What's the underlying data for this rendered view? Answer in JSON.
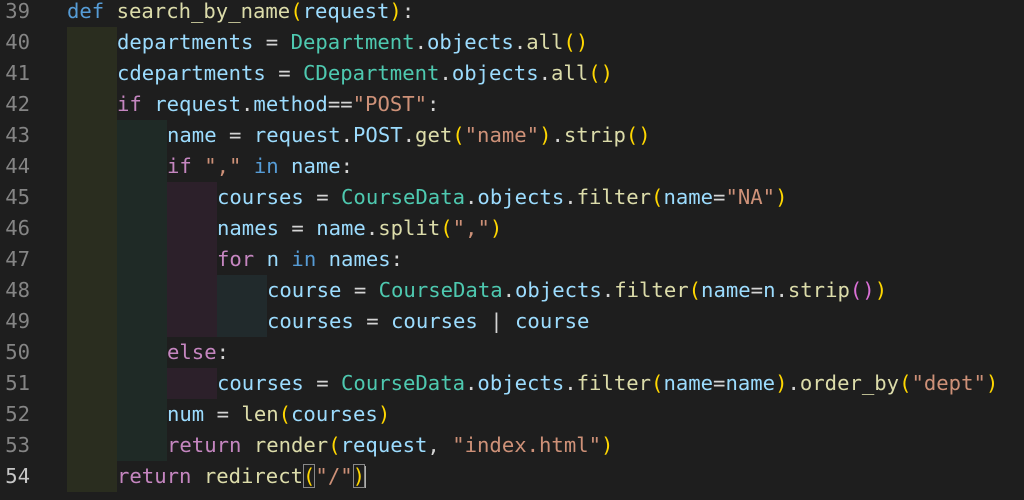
{
  "editor": {
    "language": "python",
    "theme_colors": {
      "background": "#1e1e1e",
      "keyword": "#569cd6",
      "control_keyword": "#c586c0",
      "function": "#dcdcaa",
      "class": "#4ec9b0",
      "variable": "#9cdcfe",
      "string": "#ce9178"
    },
    "current_line": 54,
    "lines": [
      {
        "number": "39",
        "text": "def search_by_name(request):"
      },
      {
        "number": "40",
        "text": "departments = Department.objects.all()"
      },
      {
        "number": "41",
        "text": "cdepartments = CDepartment.objects.all()"
      },
      {
        "number": "42",
        "text": "if request.method==\"POST\":"
      },
      {
        "number": "43",
        "text": "name = request.POST.get(\"name\").strip()"
      },
      {
        "number": "44",
        "text": "if \",\" in name:"
      },
      {
        "number": "45",
        "text": "courses = CourseData.objects.filter(name=\"NA\")"
      },
      {
        "number": "46",
        "text": "names = name.split(\",\")"
      },
      {
        "number": "47",
        "text": "for n in names:"
      },
      {
        "number": "48",
        "text": "course = CourseData.objects.filter(name=n.strip())"
      },
      {
        "number": "49",
        "text": "courses = courses | course"
      },
      {
        "number": "50",
        "text": "else:"
      },
      {
        "number": "51",
        "text": "courses = CourseData.objects.filter(name=name).order_by(\"dept\")"
      },
      {
        "number": "52",
        "text": "num = len(courses)"
      },
      {
        "number": "53",
        "text": "return render(request, \"index.html\")"
      },
      {
        "number": "54",
        "text": "return redirect(\"/\")"
      }
    ]
  }
}
